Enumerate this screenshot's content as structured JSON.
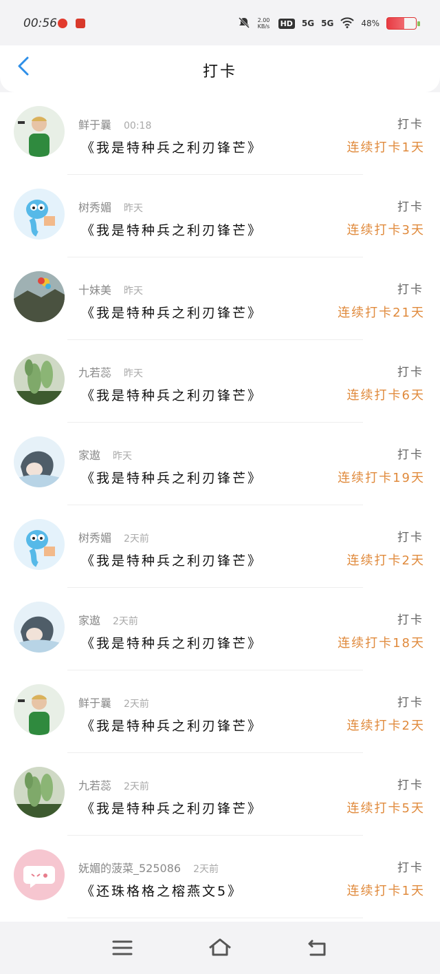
{
  "status_bar": {
    "time": "00:56",
    "net_speed": "2.00 KB/s",
    "hd": "HD",
    "sig1": "5G",
    "sig2": "5G",
    "battery": "48%"
  },
  "header": {
    "title": "打卡"
  },
  "entries": [
    {
      "user": "鲜于曩",
      "time": "00:18",
      "book": "《我是特种兵之利刃锋芒》",
      "action": "打卡",
      "streak": "连续打卡1天",
      "avatar": "boy-icon"
    },
    {
      "user": "树秀媚",
      "time": "昨天",
      "book": "《我是特种兵之利刃锋芒》",
      "action": "打卡",
      "streak": "连续打卡3天",
      "avatar": "blue-monster-icon"
    },
    {
      "user": "十妹美",
      "time": "昨天",
      "book": "《我是特种兵之利刃锋芒》",
      "action": "打卡",
      "streak": "连续打卡21天",
      "avatar": "landscape-icon"
    },
    {
      "user": "九若蕊",
      "time": "昨天",
      "book": "《我是特种兵之利刃锋芒》",
      "action": "打卡",
      "streak": "连续打卡6天",
      "avatar": "cactus-icon"
    },
    {
      "user": "家遨",
      "time": "昨天",
      "book": "《我是特种兵之利刃锋芒》",
      "action": "打卡",
      "streak": "连续打卡19天",
      "avatar": "girl-icon"
    },
    {
      "user": "树秀媚",
      "time": "2天前",
      "book": "《我是特种兵之利刃锋芒》",
      "action": "打卡",
      "streak": "连续打卡2天",
      "avatar": "blue-monster-icon"
    },
    {
      "user": "家遨",
      "time": "2天前",
      "book": "《我是特种兵之利刃锋芒》",
      "action": "打卡",
      "streak": "连续打卡18天",
      "avatar": "girl-icon"
    },
    {
      "user": "鲜于曩",
      "time": "2天前",
      "book": "《我是特种兵之利刃锋芒》",
      "action": "打卡",
      "streak": "连续打卡2天",
      "avatar": "boy-icon"
    },
    {
      "user": "九若蕊",
      "time": "2天前",
      "book": "《我是特种兵之利刃锋芒》",
      "action": "打卡",
      "streak": "连续打卡5天",
      "avatar": "cactus-icon"
    },
    {
      "user": "妩媚的菠菜_525086",
      "time": "2天前",
      "book": "《还珠格格之榕燕文5》",
      "action": "打卡",
      "streak": "连续打卡1天",
      "avatar": "pink-chat-icon"
    }
  ],
  "colors": {
    "accent": "#2e8fe8",
    "streak": "#e08a3c"
  },
  "bottom_nav": [
    "menu-icon",
    "home-icon",
    "back-icon"
  ]
}
